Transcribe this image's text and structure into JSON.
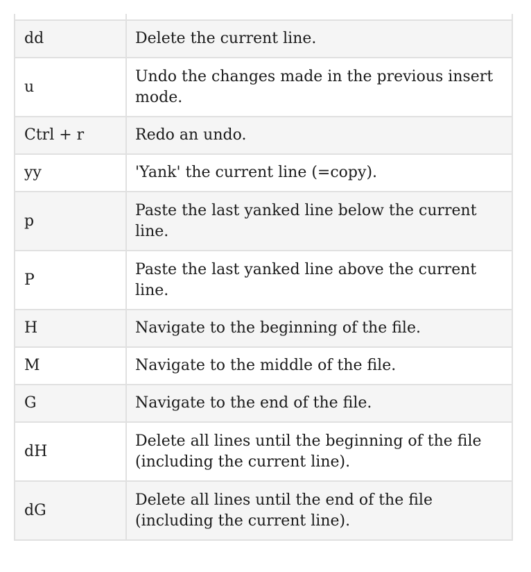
{
  "table": {
    "rows": [
      {
        "key": "dd",
        "desc": "Delete the current line."
      },
      {
        "key": "u",
        "desc": "Undo the changes made in the previous insert mode."
      },
      {
        "key": "Ctrl + r",
        "desc": "Redo an undo."
      },
      {
        "key": "yy",
        "desc": "'Yank' the current line (=copy)."
      },
      {
        "key": "p",
        "desc": "Paste the last yanked line below the current line."
      },
      {
        "key": "P",
        "desc": "Paste the last yanked line above the current line."
      },
      {
        "key": "H",
        "desc": "Navigate to the beginning of the file."
      },
      {
        "key": "M",
        "desc": "Navigate to the middle of the file."
      },
      {
        "key": "G",
        "desc": "Navigate to the end of the file."
      },
      {
        "key": "dH",
        "desc": "Delete all lines until the beginning of the file (including the current line)."
      },
      {
        "key": "dG",
        "desc": "Delete all lines until the end of the file (including the current line)."
      }
    ]
  }
}
